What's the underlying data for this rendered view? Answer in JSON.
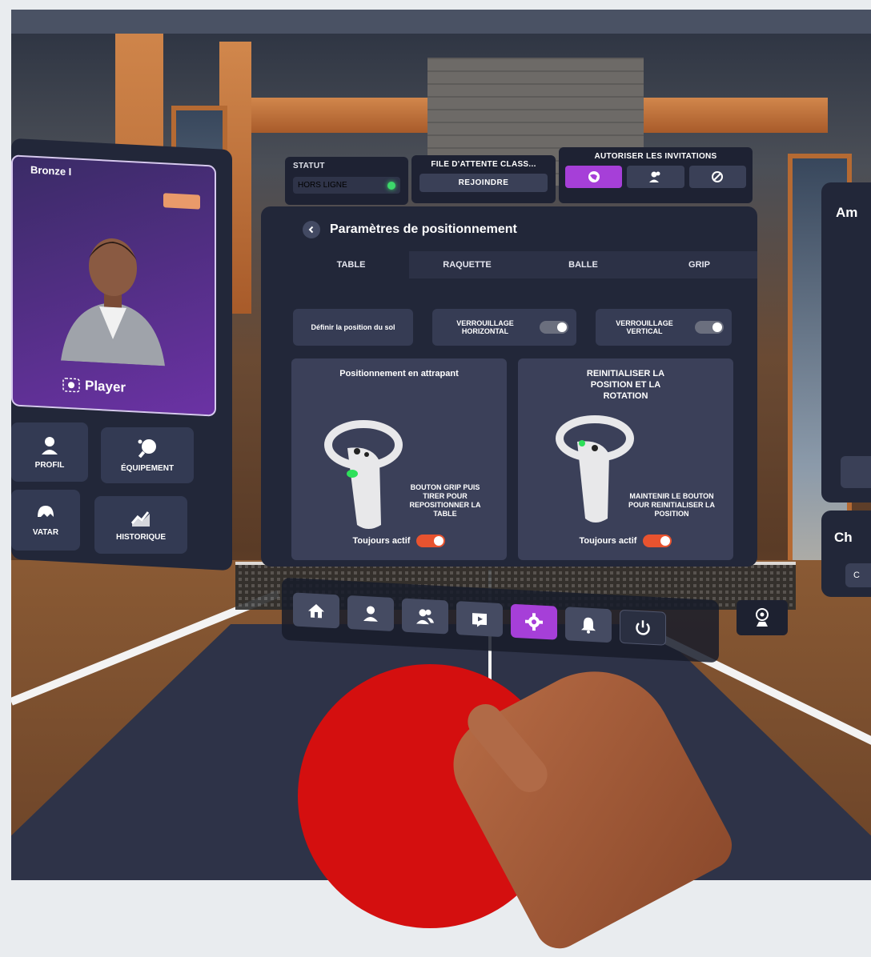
{
  "status": {
    "label": "STATUT",
    "value": "HORS LIGNE"
  },
  "queue": {
    "label": "FILE D'ATTENTE CLASS...",
    "button": "REJOINDRE"
  },
  "invitations": {
    "label": "AUTORISER LES INVITATIONS",
    "options": [
      "globe-icon",
      "friends-icon",
      "block-icon"
    ],
    "active_index": 0
  },
  "settings": {
    "title": "Paramètres de positionnement",
    "tabs": [
      "TABLE",
      "RAQUETTE",
      "BALLE",
      "GRIP"
    ],
    "active_tab": "TABLE",
    "controls": {
      "floor_button": "Définir la position du sol",
      "horizontal_lock": "VERROUILLAGE HORIZONTAL",
      "vertical_lock": "VERROUILLAGE VERTICAL"
    },
    "card_left": {
      "title": "Positionnement en attrapant",
      "description": "BOUTON GRIP PUIS TIRER POUR REPOSITIONNER LA TABLE",
      "always_label": "Toujours actif"
    },
    "card_right": {
      "title": "REINITIALISER LA POSITION ET LA ROTATION",
      "description": "MAINTENIR LE BOUTON POUR REINITIALISER LA POSITION",
      "always_label": "Toujours actif"
    }
  },
  "profile": {
    "rank": "Bronze I",
    "player_name": "Player",
    "buttons": {
      "profile": "PROFIL",
      "equipment": "ÉQUIPEMENT",
      "avatar": "VATAR",
      "history": "HISTORIQUE"
    }
  },
  "right_panel": {
    "title_partial": "Am",
    "subtitle_partial": "Ch",
    "button_partial": "C"
  },
  "menubar": {
    "items": [
      "home-icon",
      "profile-icon",
      "friends-icon",
      "video-icon",
      "settings-icon",
      "notifications-icon",
      "power-icon"
    ],
    "active": "settings-icon"
  },
  "colors": {
    "panel": "#222739",
    "accent_purple": "#a63fd8",
    "toggle_on": "#e8532f",
    "status_online": "#3dd86b",
    "paddle_red": "#d40f0f"
  }
}
